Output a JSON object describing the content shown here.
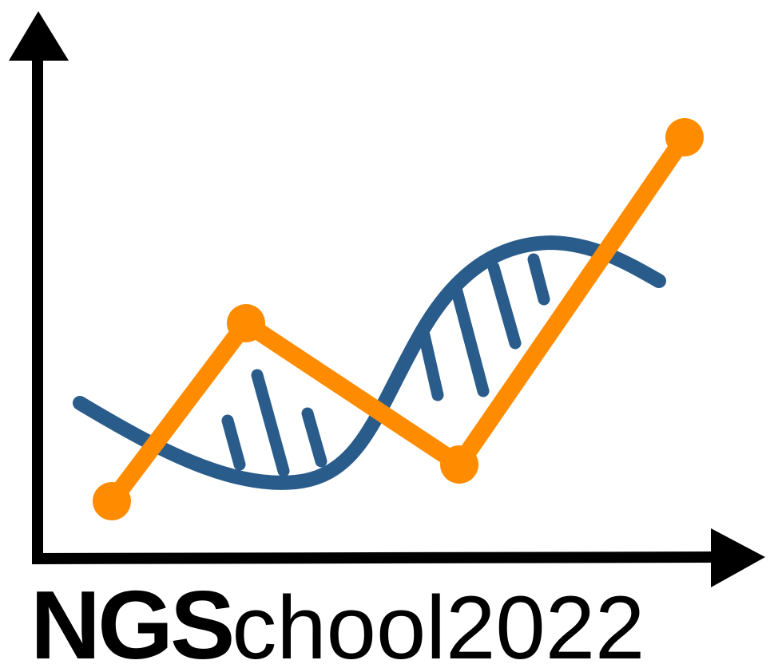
{
  "logo": {
    "text_bold": "NGS",
    "text_regular": "chool2022"
  },
  "colors": {
    "axis": "#000000",
    "orange": "#FF8C00",
    "blue": "#2A5C8B"
  },
  "icons": [
    "y-axis-arrow-icon",
    "x-axis-arrow-icon",
    "orange-line-icon",
    "dna-helix-icon"
  ]
}
